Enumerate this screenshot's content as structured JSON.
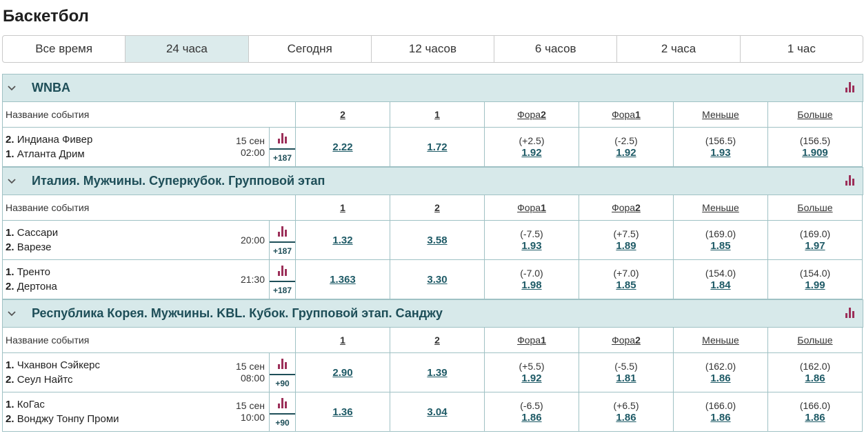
{
  "page": {
    "title": "Баскетбол"
  },
  "filters": [
    "Все время",
    "24 часа",
    "Сегодня",
    "12 часов",
    "6 часов",
    "2 часа",
    "1 час"
  ],
  "active_filter": 1,
  "colors": {
    "accent": "#1e4e58",
    "header_bg": "#d7e9ea",
    "stats_icon": "#9c2f59"
  },
  "leagues": [
    {
      "name": "WNBA",
      "head": {
        "event": "Название события",
        "c1": "2",
        "c2": "1",
        "c3a": "Фора",
        "c3b": "2",
        "c4a": "Фора",
        "c4b": "1",
        "c5": "Меньше",
        "c6": "Больше"
      },
      "events": [
        {
          "t1n": "2.",
          "t1": "Индиана Фивер",
          "t2n": "1.",
          "t2": "Атланта Дрим",
          "date": "15 сен",
          "time": "02:00",
          "more": "+187",
          "o1": "2.22",
          "o2": "1.72",
          "h1p": "(+2.5)",
          "h1": "1.92",
          "h2p": "(-2.5)",
          "h2": "1.92",
          "lp": "(156.5)",
          "l": "1.93",
          "gp": "(156.5)",
          "g": "1.909"
        }
      ]
    },
    {
      "name": "Италия. Мужчины. Суперкубок. Групповой этап",
      "head": {
        "event": "Название события",
        "c1": "1",
        "c2": "2",
        "c3a": "Фора",
        "c3b": "1",
        "c4a": "Фора",
        "c4b": "2",
        "c5": "Меньше",
        "c6": "Больше"
      },
      "events": [
        {
          "t1n": "1.",
          "t1": "Сассари",
          "t2n": "2.",
          "t2": "Варезе",
          "date": "",
          "time": "20:00",
          "more": "+187",
          "o1": "1.32",
          "o2": "3.58",
          "h1p": "(-7.5)",
          "h1": "1.93",
          "h2p": "(+7.5)",
          "h2": "1.89",
          "lp": "(169.0)",
          "l": "1.85",
          "gp": "(169.0)",
          "g": "1.97"
        },
        {
          "t1n": "1.",
          "t1": "Тренто",
          "t2n": "2.",
          "t2": "Дертона",
          "date": "",
          "time": "21:30",
          "more": "+187",
          "o1": "1.363",
          "o2": "3.30",
          "h1p": "(-7.0)",
          "h1": "1.98",
          "h2p": "(+7.0)",
          "h2": "1.85",
          "lp": "(154.0)",
          "l": "1.84",
          "gp": "(154.0)",
          "g": "1.99"
        }
      ]
    },
    {
      "name": "Республика Корея. Мужчины. KBL. Кубок. Групповой этап. Санджу",
      "head": {
        "event": "Название события",
        "c1": "1",
        "c2": "2",
        "c3a": "Фора",
        "c3b": "1",
        "c4a": "Фора",
        "c4b": "2",
        "c5": "Меньше",
        "c6": "Больше"
      },
      "events": [
        {
          "t1n": "1.",
          "t1": "Чханвон Сэйкерс",
          "t2n": "2.",
          "t2": "Сеул Найтс",
          "date": "15 сен",
          "time": "08:00",
          "more": "+90",
          "o1": "2.90",
          "o2": "1.39",
          "h1p": "(+5.5)",
          "h1": "1.92",
          "h2p": "(-5.5)",
          "h2": "1.81",
          "lp": "(162.0)",
          "l": "1.86",
          "gp": "(162.0)",
          "g": "1.86"
        },
        {
          "t1n": "1.",
          "t1": "КоГас",
          "t2n": "2.",
          "t2": "Вонджу Тонпу Проми",
          "date": "15 сен",
          "time": "10:00",
          "more": "+90",
          "o1": "1.36",
          "o2": "3.04",
          "h1p": "(-6.5)",
          "h1": "1.86",
          "h2p": "(+6.5)",
          "h2": "1.86",
          "lp": "(166.0)",
          "l": "1.86",
          "gp": "(166.0)",
          "g": "1.86"
        }
      ]
    }
  ]
}
